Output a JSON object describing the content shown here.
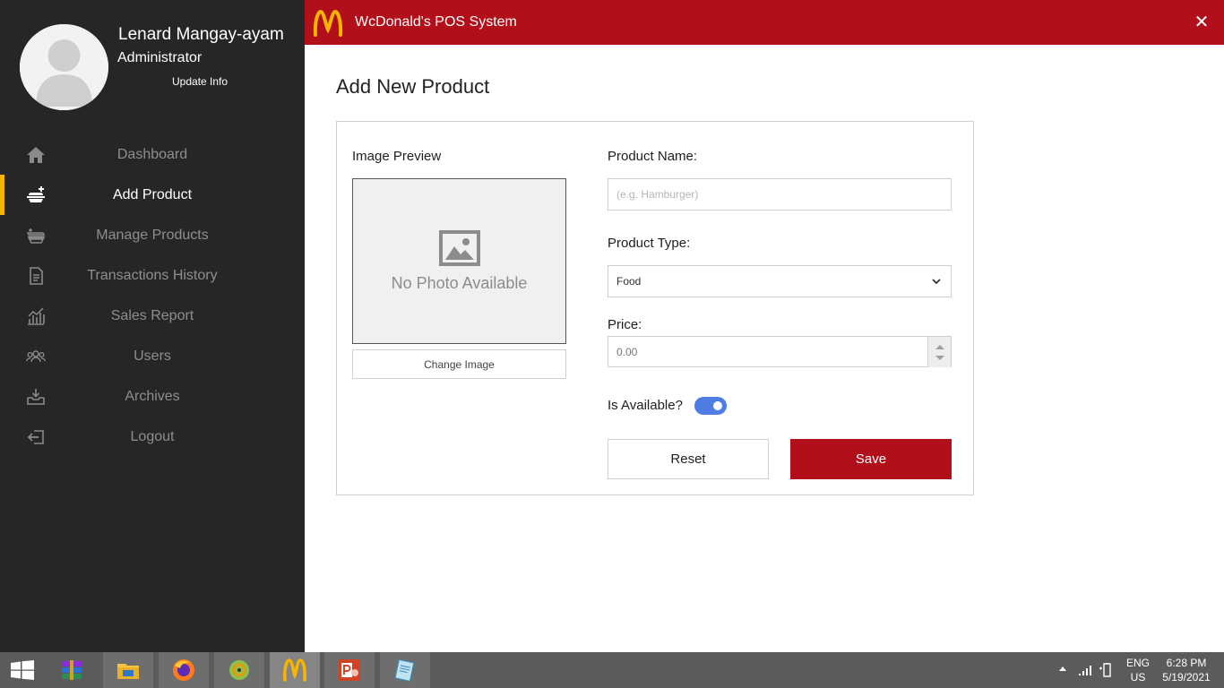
{
  "window": {
    "title": "WcDonald's POS System",
    "close_glyph": "✕",
    "accent_color": "#b10f19"
  },
  "user": {
    "name": "Lenard Mangay-ayam",
    "role": "Administrator",
    "update_label": "Update Info"
  },
  "sidebar": {
    "items": [
      {
        "label": "Dashboard",
        "icon": "home-icon",
        "active": false
      },
      {
        "label": "Add Product",
        "icon": "add-product-icon",
        "active": true
      },
      {
        "label": "Manage Products",
        "icon": "manage-products-icon",
        "active": false
      },
      {
        "label": "Transactions History",
        "icon": "document-icon",
        "active": false
      },
      {
        "label": "Sales Report",
        "icon": "chart-icon",
        "active": false
      },
      {
        "label": "Users",
        "icon": "users-icon",
        "active": false
      },
      {
        "label": "Archives",
        "icon": "archive-icon",
        "active": false
      },
      {
        "label": "Logout",
        "icon": "logout-icon",
        "active": false
      }
    ]
  },
  "form": {
    "page_title": "Add New Product",
    "image_preview_label": "Image Preview",
    "no_photo_text": "No Photo Available",
    "change_image_label": "Change Image",
    "product_name_label": "Product Name:",
    "product_name_placeholder": "(e.g. Hamburger)",
    "product_type_label": "Product Type:",
    "product_type_value": "Food",
    "price_label": "Price:",
    "price_value": "0.00",
    "available_label": "Is Available?",
    "available_on": true,
    "reset_label": "Reset",
    "save_label": "Save"
  },
  "taskbar": {
    "apps": [
      "winrar-icon",
      "file-explorer-icon",
      "firefox-icon",
      "chameleon-app-icon",
      "wcdonalds-app-icon",
      "powerpoint-icon",
      "notepad-icon"
    ],
    "lang_line1": "ENG",
    "lang_line2": "US",
    "time": "6:28 PM",
    "date": "5/19/2021"
  }
}
